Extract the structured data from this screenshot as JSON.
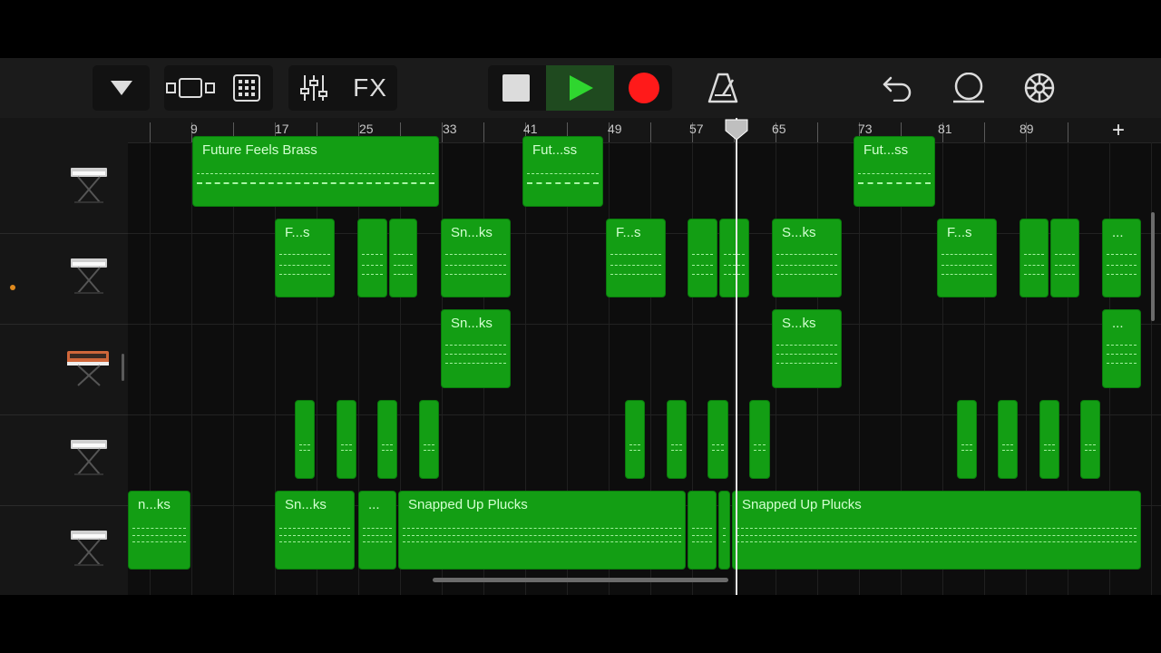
{
  "toolbar": {
    "icons": [
      "triangle-down-icon",
      "view-toggle-icon",
      "grid-icon",
      "mixer-icon",
      "fx-label",
      "stop-icon",
      "play-icon",
      "record-icon",
      "metronome-icon",
      "undo-icon",
      "loop-icon",
      "settings-icon"
    ],
    "fx_label": "FX"
  },
  "ruler": {
    "bars": [
      "9",
      "17",
      "25",
      "33",
      "41",
      "49",
      "57",
      "65",
      "73",
      "81",
      "89"
    ]
  },
  "tracks": [
    {
      "instrument": "keyboard-icon",
      "color": "#d0d0d0"
    },
    {
      "instrument": "keyboard-icon",
      "color": "#d0d0d0"
    },
    {
      "instrument": "synth-icon",
      "color": "#d0673a"
    },
    {
      "instrument": "keyboard-icon",
      "color": "#d0d0d0"
    },
    {
      "instrument": "keyboard-icon",
      "color": "#d0d0d0"
    }
  ],
  "clips": {
    "t1": [
      "Future Feels Brass",
      "Fut...ss",
      "Fut...ss"
    ],
    "t2": [
      "F...s",
      "",
      "",
      "Sn...ks",
      "F...s",
      "",
      "",
      "S...ks",
      "F...s",
      "",
      "",
      "..."
    ],
    "t3": [
      "Sn...ks",
      "S...ks",
      "..."
    ],
    "t5": [
      "n...ks",
      "Sn...ks",
      "...",
      "Snapped Up Plucks",
      "",
      "",
      "Snapped Up Plucks"
    ]
  },
  "colors": {
    "clip": "#139e14",
    "record": "#ff1a1a",
    "play": "#2fd62f",
    "accent": "#e08a1e"
  }
}
